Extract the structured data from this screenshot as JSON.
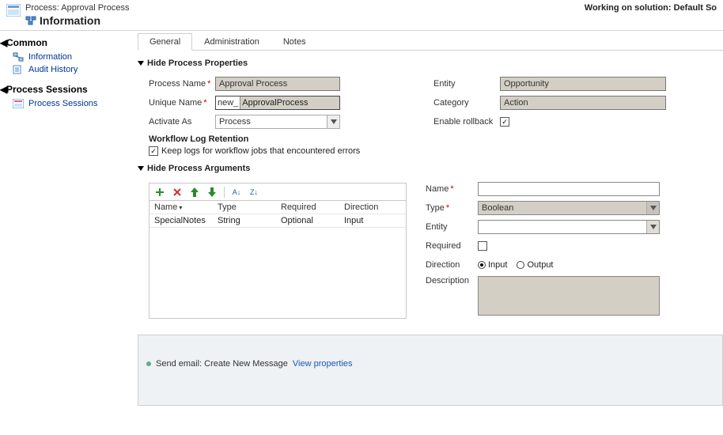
{
  "header": {
    "process_label": "Process: Approval Process",
    "info_title": "Information",
    "working_on": "Working on solution: Default So"
  },
  "sidebar": {
    "section_common": "Common",
    "item_information": "Information",
    "item_audit": "Audit History",
    "section_sessions": "Process Sessions",
    "item_sessions": "Process Sessions"
  },
  "tabs": {
    "general": "General",
    "administration": "Administration",
    "notes": "Notes"
  },
  "props": {
    "section_title": "Hide Process Properties",
    "process_name_lbl": "Process Name",
    "process_name_val": "Approval Process",
    "unique_name_lbl": "Unique Name",
    "unique_name_prefix": "new_",
    "unique_name_val": "ApprovalProcess",
    "activate_as_lbl": "Activate As",
    "activate_as_val": "Process",
    "entity_lbl": "Entity",
    "entity_val": "Opportunity",
    "category_lbl": "Category",
    "category_val": "Action",
    "rollback_lbl": "Enable rollback",
    "wf_log_title": "Workflow Log Retention",
    "wf_log_opt": "Keep logs for workflow jobs that encountered errors"
  },
  "args": {
    "section_title": "Hide Process Arguments",
    "col_name": "Name",
    "col_type": "Type",
    "col_required": "Required",
    "col_direction": "Direction",
    "rows": [
      {
        "name": "SpecialNotes",
        "type": "String",
        "required": "Optional",
        "direction": "Input"
      }
    ],
    "form": {
      "name_lbl": "Name",
      "type_lbl": "Type",
      "type_val": "Boolean",
      "entity_lbl": "Entity",
      "required_lbl": "Required",
      "direction_lbl": "Direction",
      "dir_input": "Input",
      "dir_output": "Output",
      "description_lbl": "Description"
    }
  },
  "steps": {
    "line_text": "Send email:  Create New Message",
    "view_props": "View properties"
  }
}
